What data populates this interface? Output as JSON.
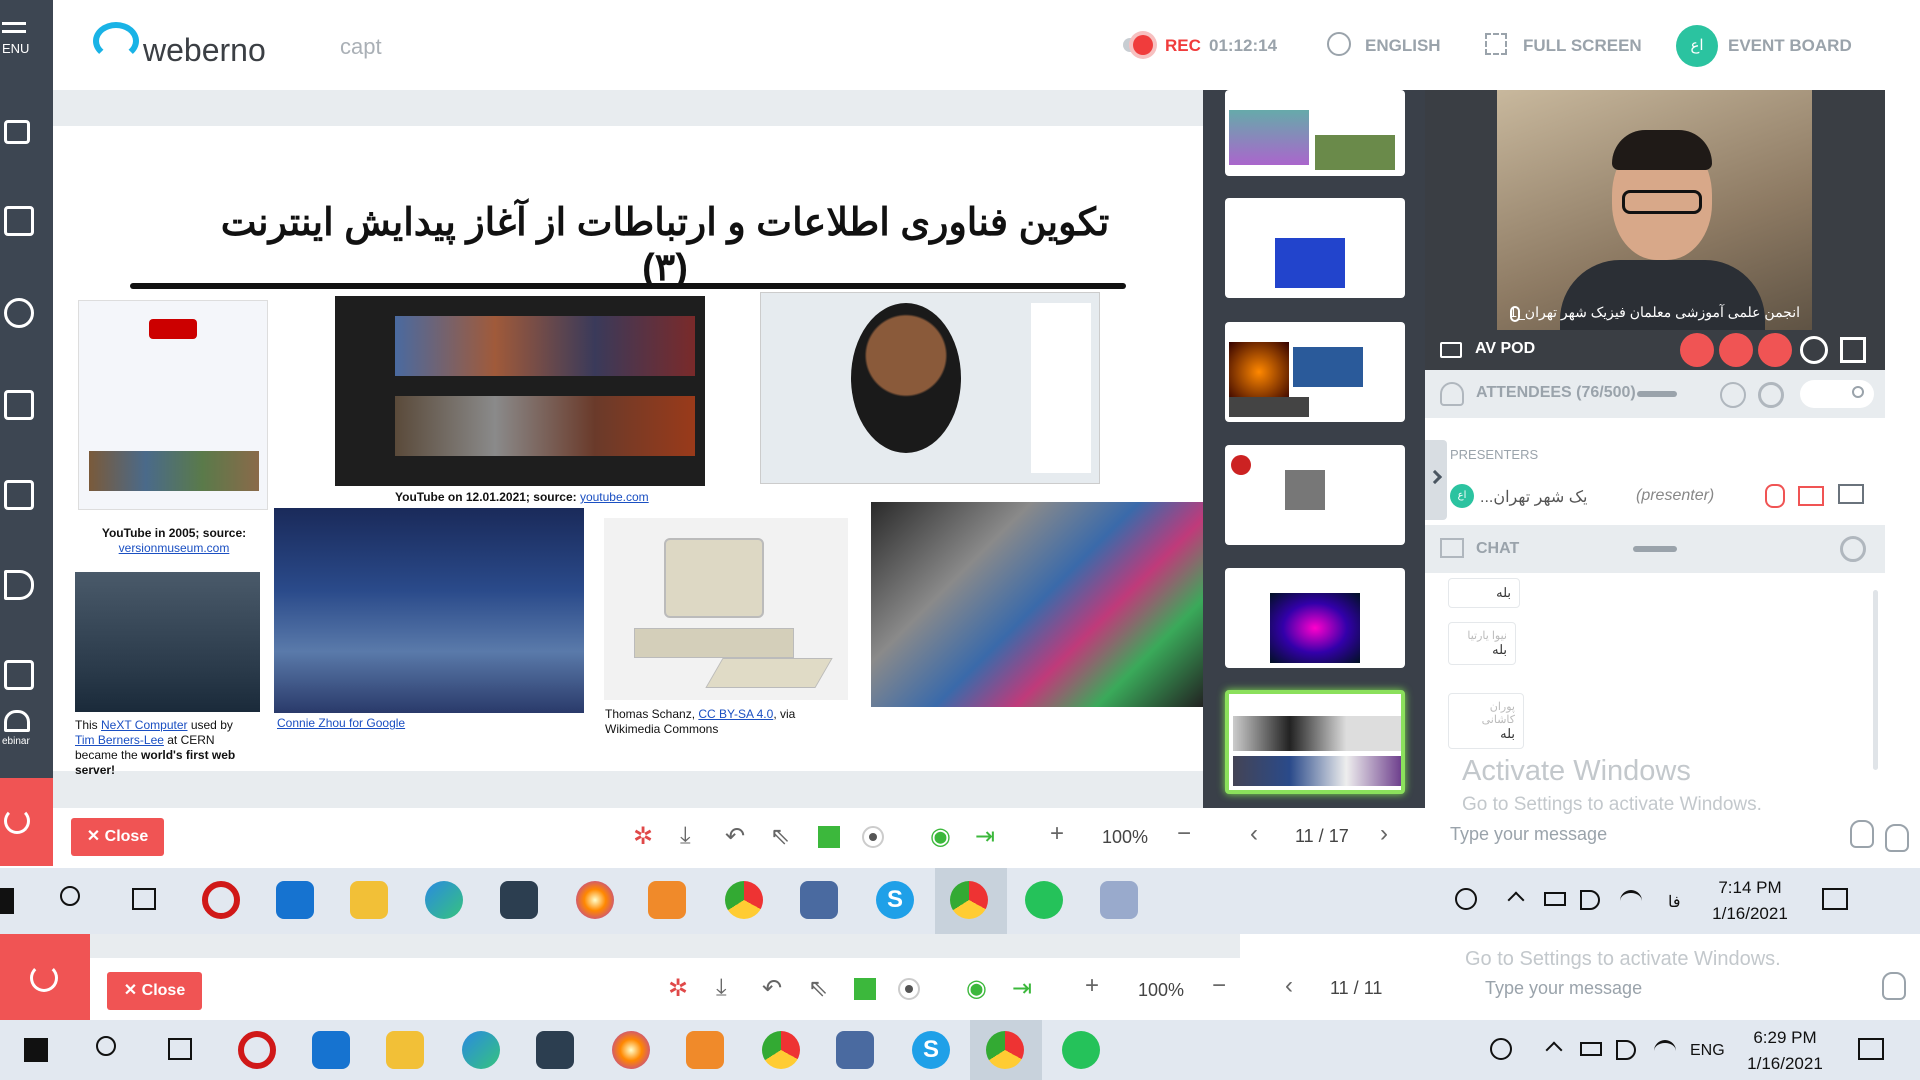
{
  "sidebar": {
    "menu_label": "ENU",
    "webinar_label": "ebinar"
  },
  "header": {
    "logo_text": "weberno",
    "session_name": "capt",
    "rec_label": "REC",
    "rec_time": "01:12:14",
    "language_label": "ENGLISH",
    "fullscreen_label": "FULL SCREEN",
    "event_board_label": "EVENT BOARD",
    "avatar_initials": "اع"
  },
  "slide": {
    "title": "تکوین فناوری اطلاعات و ارتباطات از آغاز پیدایش اینترنت (۳)",
    "captions": {
      "youtube2021_text": "YouTube on 12.01.2021; source: ",
      "youtube2021_link": "youtube.com",
      "youtube2005_text": "YouTube in 2005; source:",
      "youtube2005_link": "versionmuseum.com",
      "next_prefix": "This ",
      "next_link": "NeXT Computer",
      "next_mid": " used by ",
      "next_person": "Tim Berners-Lee",
      "next_suffix": " at CERN became the ",
      "next_bold": "world's first web server!",
      "google_link": "Connie Zhou for Google",
      "schanz_prefix": "Thomas Schanz, ",
      "schanz_link": "CC BY-SA 4.0",
      "schanz_suffix": ", via Wikimedia Commons"
    }
  },
  "video": {
    "name": "انجمن علمی آموزشی معلمان فیزیک شهر تهران_1",
    "av_label": "AV POD"
  },
  "attendees": {
    "label": "ATTENDEES (76/500)",
    "presenters_label": "PRESENTERS",
    "presenter_name": "...یک شهر تهران",
    "presenter_role": "(presenter)",
    "presenter_initials": "اع"
  },
  "chat": {
    "label": "CHAT",
    "messages": [
      {
        "author": "",
        "text": "بله"
      },
      {
        "author": "نیوا یارتیا",
        "text": "بله"
      },
      {
        "author": "پوران کاشانی",
        "text": "بله"
      }
    ],
    "placeholder": "Type your message"
  },
  "watermark": {
    "title": "Activate Windows",
    "subtitle": "Go to Settings to activate Windows."
  },
  "toolbar": {
    "close_label": "Close",
    "zoom": "100%",
    "page": "11 / 17"
  },
  "taskbar": {
    "time": "7:14 PM",
    "date": "1/16/2021",
    "lang": "فا"
  },
  "strip": {
    "close_label": "Close",
    "zoom": "100%",
    "page": "11 / 11",
    "activate_sub": "Go to Settings to activate Windows.",
    "placeholder": "Type your message"
  },
  "taskbar2": {
    "time": "6:29 PM",
    "date": "1/16/2021",
    "lang": "ENG"
  },
  "colors": {
    "accent": "#2bc3a0",
    "danger": "#f05454",
    "sidebar": "#3d4652",
    "active_thumb": "#8be05c"
  }
}
